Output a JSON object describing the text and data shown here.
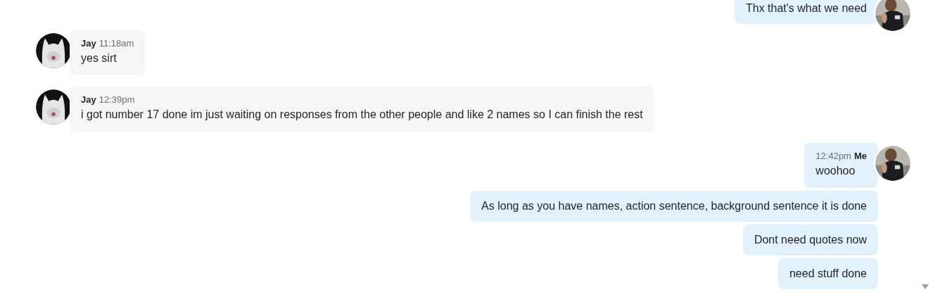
{
  "groups": [
    {
      "mine": true,
      "messages": [
        "Thx that's what we need"
      ]
    },
    {
      "mine": false,
      "sender": "Jay",
      "time": "11:18am",
      "messages": [
        "yes sirt"
      ]
    },
    {
      "mine": false,
      "sender": "Jay",
      "time": "12:39pm",
      "messages": [
        "i got number 17 done im just waiting on responses from the other people and like 2 names so I can finish the rest"
      ]
    },
    {
      "mine": true,
      "sender": "Me",
      "time": "12:42pm",
      "messages": [
        "woohoo",
        "As long as you have names, action sentence, background sentence it is done",
        "Dont need quotes now",
        "need stuff done"
      ]
    }
  ]
}
